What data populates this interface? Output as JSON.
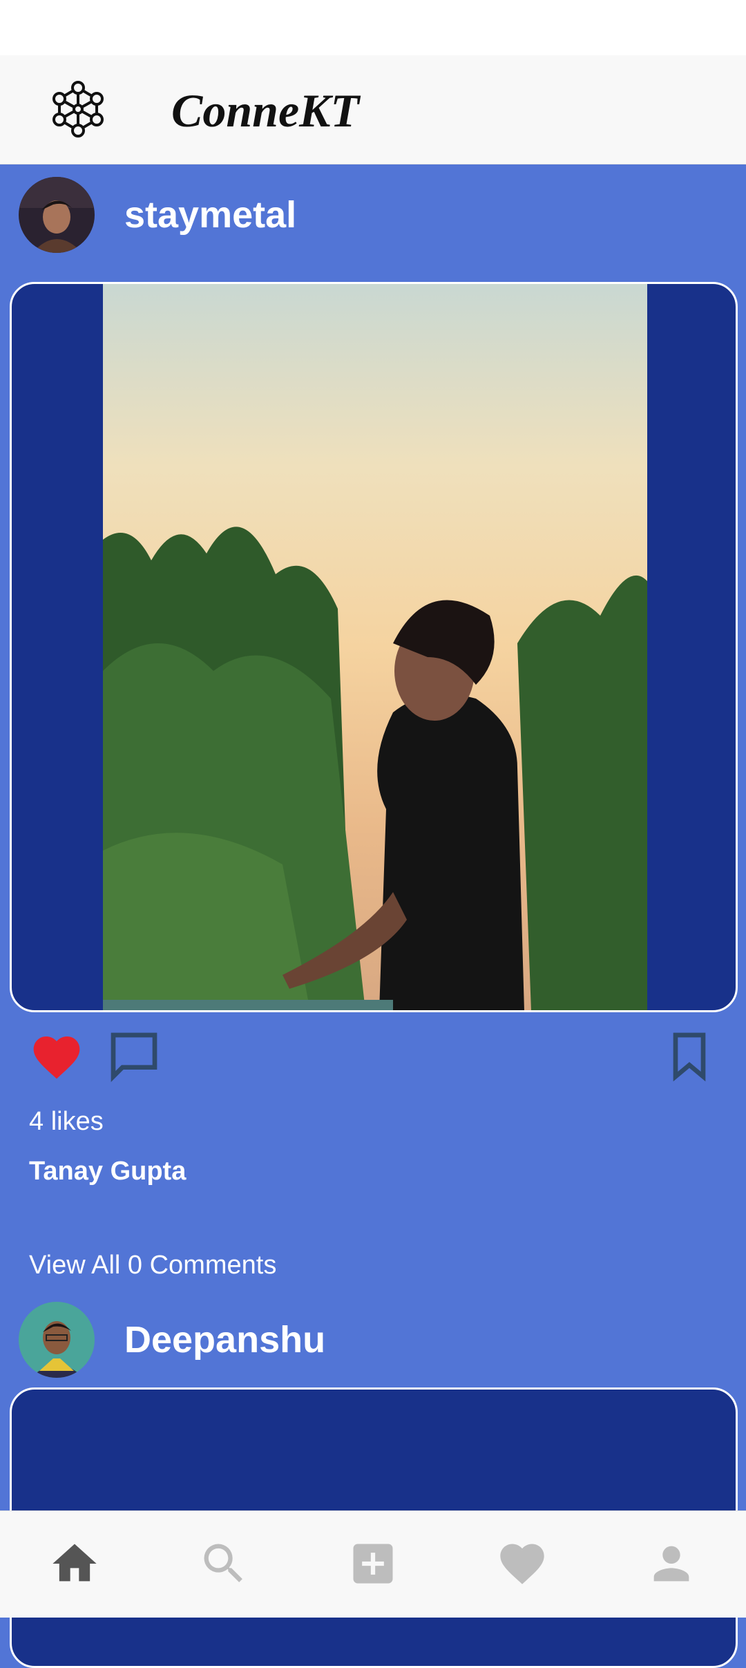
{
  "app": {
    "title": "ConneKT"
  },
  "posts": [
    {
      "username": "staymetal",
      "likes_text": "4 likes",
      "caption_name": "Tanay Gupta",
      "comments_link": "View All 0 Comments",
      "liked": true
    },
    {
      "username": "Deepanshu"
    }
  ],
  "nav": {
    "items": [
      "home-icon",
      "search-icon",
      "add-post-icon",
      "activity-heart-icon",
      "profile-icon"
    ],
    "active": "home-icon"
  },
  "colors": {
    "background": "#5275d6",
    "media_frame": "#18318a",
    "like_red": "#e8222e",
    "nav_active": "#555555",
    "nav_inactive": "#bdbdbd"
  }
}
